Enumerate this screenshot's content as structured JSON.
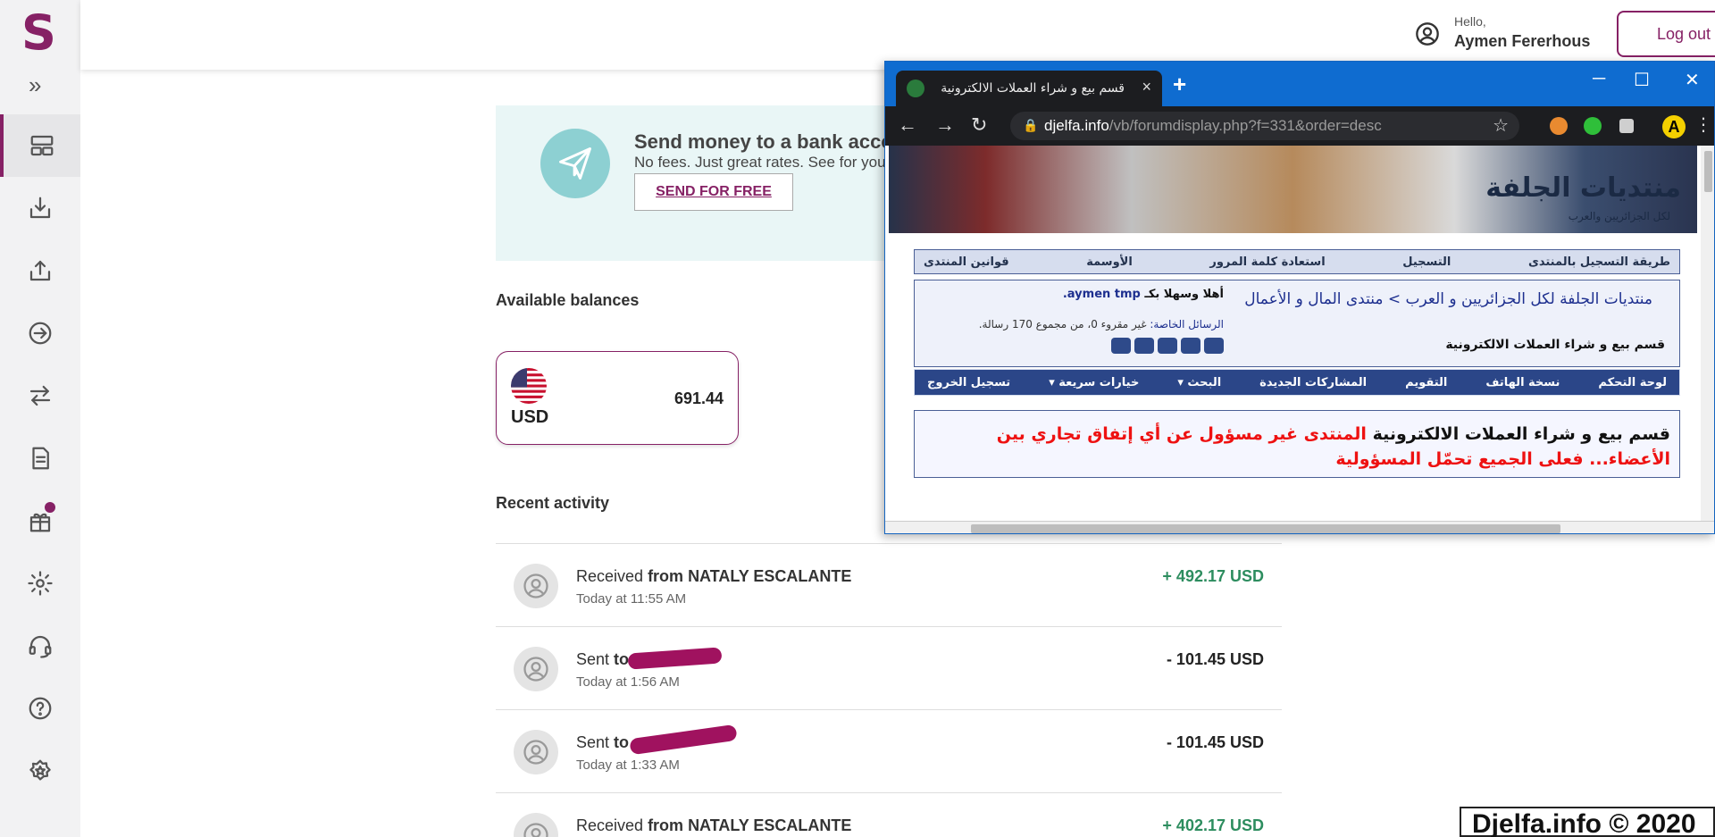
{
  "skrill": {
    "logo": "S",
    "expand": "»",
    "header": {
      "hello": "Hello,",
      "user": "Aymen Fererhous",
      "logout": "Log out"
    },
    "promo": {
      "title": "Send money to a bank accou",
      "subtitle": "No fees. Just great rates. See for you",
      "button": "SEND FOR FREE"
    },
    "balances": {
      "heading": "Available balances",
      "card": {
        "currency": "USD",
        "amount": "691.44"
      }
    },
    "activity": {
      "heading": "Recent activity",
      "rows": [
        {
          "verb": "Received",
          "party": "from NATALY ESCALANTE",
          "time": "Today at 11:55 AM",
          "amount": "+ 492.17 USD",
          "positive": true
        },
        {
          "verb": "Sent",
          "party": "to",
          "time": "Today at 1:56 AM",
          "amount": "- 101.45 USD",
          "positive": false
        },
        {
          "verb": "Sent",
          "party": "to",
          "time": "Today at 1:33 AM",
          "amount": "- 101.45 USD",
          "positive": false
        },
        {
          "verb": "Received",
          "party": "from NATALY ESCALANTE",
          "time": "",
          "amount": "+ 402.17 USD",
          "positive": true
        }
      ]
    },
    "colors": {
      "brand": "#862165",
      "positive": "#2d8d5f"
    }
  },
  "chrome": {
    "tab_title": "قسم بيع و شراء العملات الالكترونية",
    "tab_close": "×",
    "new_tab": "+",
    "window": {
      "minimize": "─",
      "maximize": "☐",
      "close": "✕"
    },
    "nav": {
      "back": "←",
      "forward": "→",
      "reload": "↻"
    },
    "url_domain": "djelfa.info",
    "url_path": "/vb/forumdisplay.php?f=331&order=desc",
    "profile_initial": "A",
    "page": {
      "banner_logo": "منتديات الجلفة",
      "banner_sub": "لكل الجزائريين والعرب",
      "top_nav": [
        "طريقة التسجيل بالمنتدى",
        "التسجيل",
        "استعادة كلمة المرور",
        "الأوسمة",
        "قوانين المنتدى"
      ],
      "breadcrumb": "منتديات الجلفة لكل الجزائريين و العرب > منتدى المال و الأعمال",
      "current_forum": "قسم بيع و شراء العملات الالكترونية",
      "welcome_prefix": "أهلا وسهلا بكـ",
      "welcome_user": "aymen tmp.",
      "pm_label": "الرسائل الخاصة:",
      "pm_text": "غير مقروء 0، من مجموع 170 رسالة.",
      "bottom_nav": [
        "لوحة التحكم",
        "نسخة الهاتف",
        "التقويم",
        "المشاركات الجديدة",
        "البحث ▾",
        "خيارات سريعة ▾",
        "تسجيل الخروج"
      ],
      "notice_black": "قسم بيع و شراء العملات الالكترونية",
      "notice_red": "المنتدى غير مسؤول عن أي إتفاق تجاري بين الأعضاء... فعلى الجميع تحمّل المسؤولية"
    }
  },
  "watermark": "Djelfa.info © 2020"
}
